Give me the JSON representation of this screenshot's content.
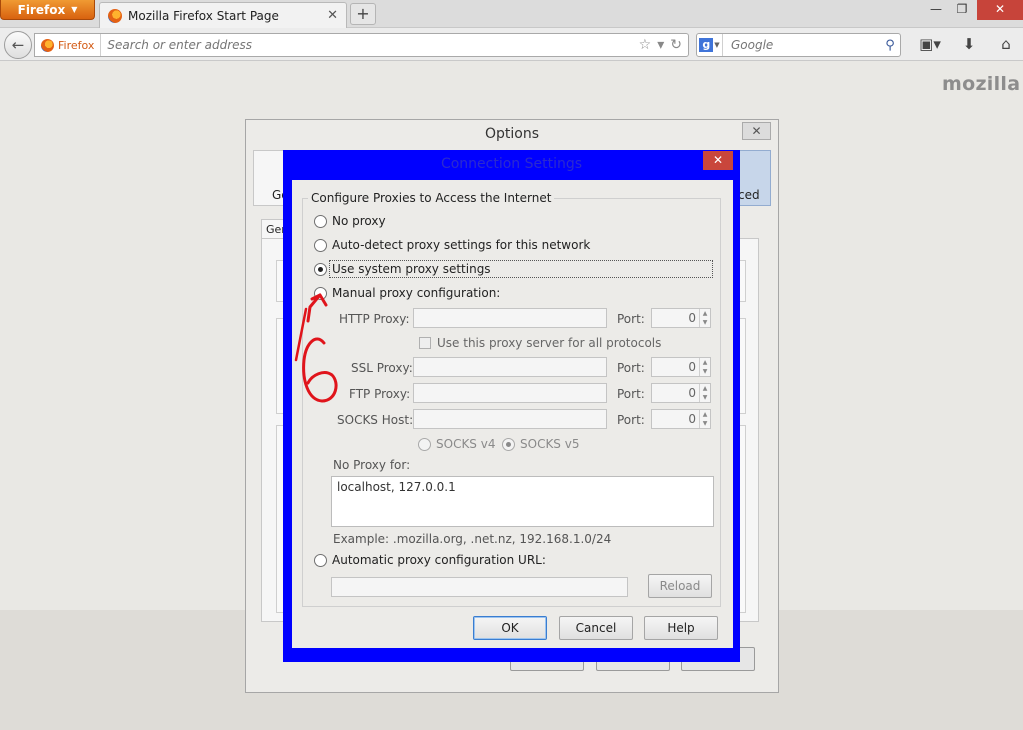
{
  "browser": {
    "menu_label": "Firefox",
    "tab_title": "Mozilla Firefox Start Page",
    "identity_label": "Firefox",
    "url_placeholder": "Search or enter address",
    "search_placeholder": "Google",
    "brand_logo": "mozilla"
  },
  "options": {
    "title": "Options",
    "tab_general": "Ge",
    "tab_advanced": "ced",
    "subtab": "Gen"
  },
  "connection": {
    "title": "Connection Settings",
    "legend": "Configure Proxies to Access the Internet",
    "radios": {
      "no_proxy": "No proxy",
      "auto_detect": "Auto-detect proxy settings for this network",
      "system": "Use system proxy settings",
      "manual": "Manual proxy configuration:",
      "auto_url": "Automatic proxy configuration URL:"
    },
    "selected": "system",
    "http_label": "HTTP Proxy:",
    "ssl_label": "SSL Proxy:",
    "ftp_label": "FTP Proxy:",
    "socks_label": "SOCKS Host:",
    "port_label": "Port:",
    "http_port": "0",
    "ssl_port": "0",
    "ftp_port": "0",
    "socks_port": "0",
    "share_label": "Use this proxy server for all protocols",
    "socks_v4": "SOCKS v4",
    "socks_v5": "SOCKS v5",
    "no_proxy_for_label": "No Proxy for:",
    "no_proxy_for_value": "localhost, 127.0.0.1",
    "example": "Example: .mozilla.org, .net.nz, 192.168.1.0/24",
    "reload": "Reload",
    "ok": "OK",
    "cancel": "Cancel",
    "help": "Help"
  },
  "annotation": {
    "step_number": "6",
    "color": "#e0141b"
  },
  "colors": {
    "highlight_frame": "#0000ff",
    "firefox_orange": "#e66a12",
    "close_red": "#c9463c"
  }
}
